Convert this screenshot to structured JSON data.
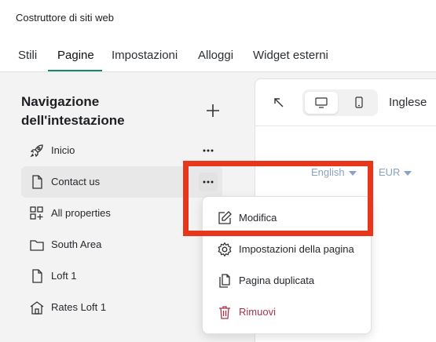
{
  "app": {
    "title": "Costruttore di siti web"
  },
  "tabs": [
    {
      "label": "Stili"
    },
    {
      "label": "Pagine",
      "active": true
    },
    {
      "label": "Impostazioni"
    },
    {
      "label": "Alloggi"
    },
    {
      "label": "Widget esterni"
    }
  ],
  "sidebar": {
    "title": "Navigazione dell'intestazione",
    "add_icon": "plus-icon",
    "items": [
      {
        "label": "Inicio",
        "icon": "rocket-icon",
        "has_more": true
      },
      {
        "label": "Contact us",
        "icon": "page-icon",
        "has_more": true,
        "hovered": true
      },
      {
        "label": "All properties",
        "icon": "grid-plus-icon"
      },
      {
        "label": "South Area",
        "icon": "folder-icon",
        "has_chevron": true
      },
      {
        "label": "Loft 1",
        "icon": "page-icon"
      },
      {
        "label": "Rates Loft 1",
        "icon": "house-icon"
      }
    ]
  },
  "preview": {
    "language": "Inglese",
    "language_select": "English",
    "currency_select": "EUR",
    "devices": [
      "desktop-icon",
      "mobile-icon"
    ],
    "selected_device": "desktop-icon"
  },
  "context_menu": {
    "items": [
      {
        "label": "Modifica",
        "icon": "edit-icon"
      },
      {
        "label": "Impostazioni della pagina",
        "icon": "gear-icon"
      },
      {
        "label": "Pagina duplicata",
        "icon": "duplicate-icon"
      },
      {
        "label": "Rimuovi",
        "icon": "trash-icon",
        "danger": true
      }
    ]
  },
  "colors": {
    "accent": "#0f8a6b",
    "danger": "#a8344a",
    "highlight": "#e8361c",
    "muted_link": "#8aa2c2"
  }
}
